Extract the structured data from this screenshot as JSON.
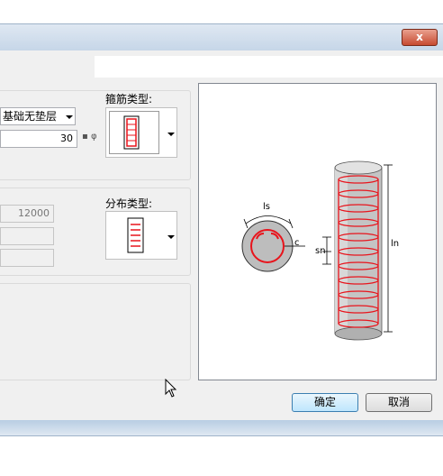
{
  "window": {
    "close_glyph": "x"
  },
  "foundation": {
    "base_type_value": "基础无垫层",
    "cover_value": "30",
    "dia_symbol": "▪ φ"
  },
  "stirrup": {
    "label": "箍筋类型:",
    "icon": "stirrup-rect-icon"
  },
  "distribution": {
    "label": "分布类型:",
    "length_value": "12000",
    "field2_value": "",
    "field3_value": "",
    "icon": "distribution-rect-icon"
  },
  "preview": {
    "label_ls": "ls",
    "label_c": "c",
    "label_sn": "sn",
    "label_ln": "ln"
  },
  "buttons": {
    "ok_label": "确定",
    "cancel_label": "取消"
  },
  "colors": {
    "accent": "#e8141c",
    "pile_gray": "#bdbdbd"
  }
}
